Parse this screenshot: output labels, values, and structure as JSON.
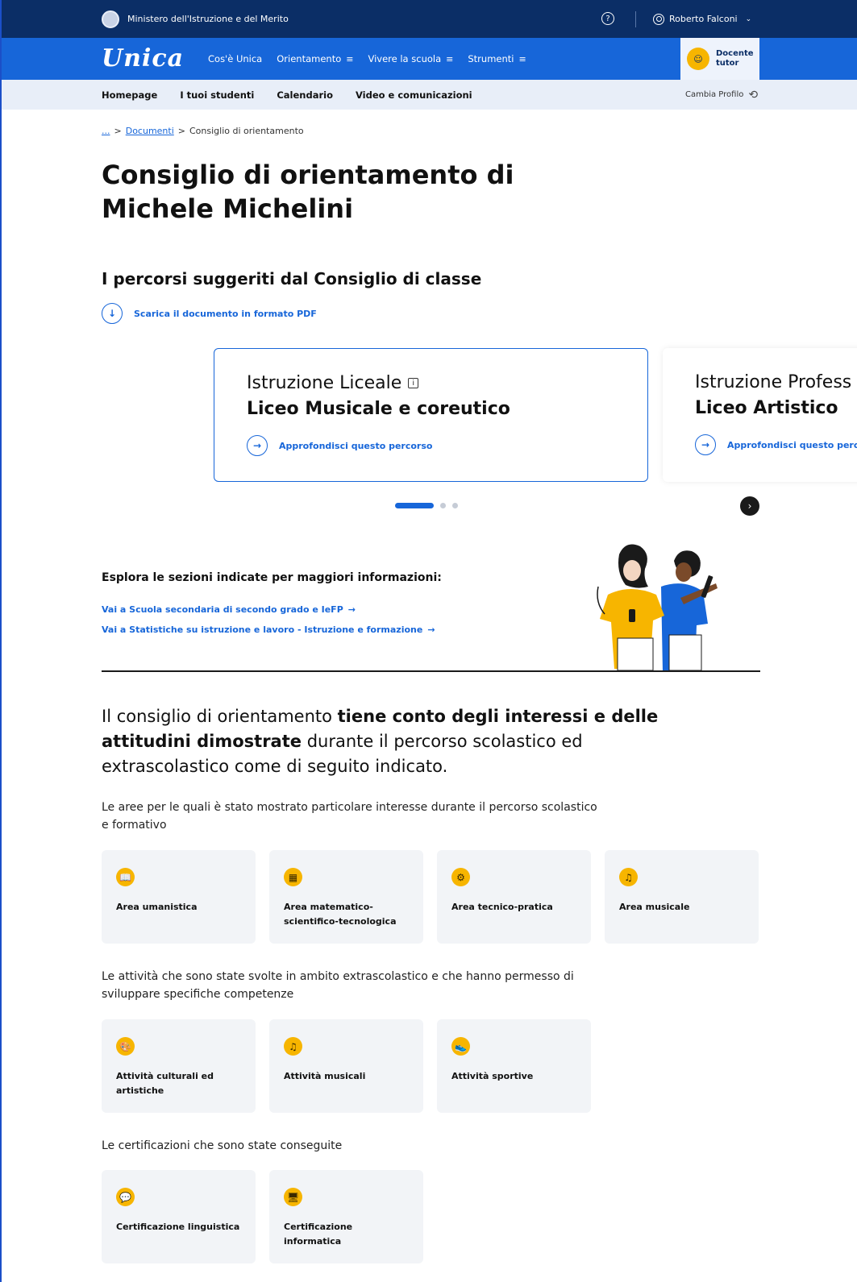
{
  "topbar": {
    "ministry": "Ministero dell'Istruzione e del Merito",
    "help_icon": "help-circle-icon",
    "user_name": "Roberto Falconi",
    "user_icon": "user-circle-icon"
  },
  "mainnav": {
    "logo": "Unica",
    "items": [
      {
        "label": "Cos'è Unica",
        "menu": false
      },
      {
        "label": "Orientamento",
        "menu": true
      },
      {
        "label": "Vivere la scuola",
        "menu": true
      },
      {
        "label": "Strumenti",
        "menu": true
      }
    ],
    "profile_line1": "Docente",
    "profile_line2": "tutor"
  },
  "subnav": {
    "items": [
      "Homepage",
      "I tuoi studenti",
      "Calendario",
      "Video e comunicazioni"
    ],
    "change_profile": "Cambia Profilo"
  },
  "breadcrumb": {
    "ellipsis": "...",
    "sep": ">",
    "parent": "Documenti",
    "current": "Consiglio di orientamento"
  },
  "page": {
    "title_line1": "Consiglio di orientamento di",
    "title_line2": "Michele Michelini",
    "section_title": "I percorsi suggeriti dal Consiglio di classe",
    "download_label": "Scarica il documento in formato PDF"
  },
  "cards": [
    {
      "type": "Istruzione Liceale",
      "name": "Liceo Musicale e coreutico",
      "more": "Approfondisci questo percorso"
    },
    {
      "type": "Istruzione Profess",
      "name": "Liceo Artistico",
      "more": "Approfondisci questo perc"
    }
  ],
  "carousel": {
    "pages": 3,
    "active": 0
  },
  "explore": {
    "title": "Esplora le sezioni indicate per maggiori informazioni:",
    "links": [
      "Vai a Scuola secondaria di secondo grado e IeFP",
      "Vai a Statistiche su istruzione e lavoro - Istruzione e formazione"
    ],
    "arrow": "→"
  },
  "statement": {
    "part1": "Il consiglio di orientamento ",
    "bold": "tiene conto degli interessi e delle attitudini dimostrate",
    "part2": " durante il percorso scolastico ed extrascolastico come di seguito indicato."
  },
  "groups": {
    "areas_label": "Le aree per le quali è stato mostrato particolare interesse durante il percorso scolastico e formativo",
    "areas": [
      {
        "label": "Area umanistica",
        "icon": "book-icon",
        "glyph": "📖"
      },
      {
        "label": "Area matematico-scientifico-tecnologica",
        "icon": "calculator-icon",
        "glyph": "▦"
      },
      {
        "label": "Area tecnico-pratica",
        "icon": "gears-icon",
        "glyph": "⚙"
      },
      {
        "label": "Area musicale",
        "icon": "music-note-icon",
        "glyph": "♫"
      }
    ],
    "activities_label": "Le attività che sono state svolte in ambito extrascolastico e che hanno permesso di sviluppare specifiche competenze",
    "activities": [
      {
        "label": "Attività culturali ed artistiche",
        "icon": "palette-icon",
        "glyph": "🎨"
      },
      {
        "label": "Attività musicali",
        "icon": "music-note-icon",
        "glyph": "♫"
      },
      {
        "label": "Attività sportive",
        "icon": "shoe-icon",
        "glyph": "👟"
      }
    ],
    "certs_label": "Le certificazioni che sono state conseguite",
    "certs": [
      {
        "label": "Certificazione linguistica",
        "icon": "speech-bubbles-icon",
        "glyph": "💬"
      },
      {
        "label": "Certificazione informatica",
        "icon": "computer-icon",
        "glyph": "🖥"
      }
    ]
  },
  "colors": {
    "ministry_bar": "#0b2e66",
    "primary": "#1766d9",
    "accent": "#f7b500",
    "tile_bg": "#f2f4f7"
  }
}
